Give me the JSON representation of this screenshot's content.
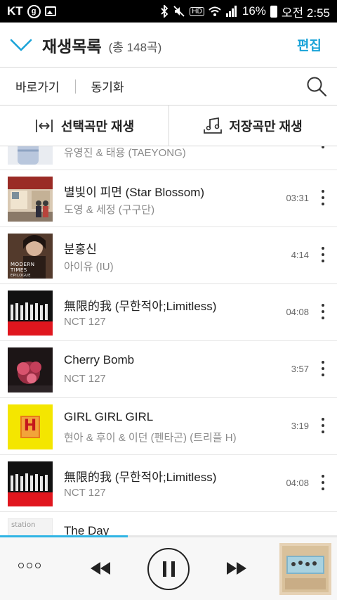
{
  "status_bar": {
    "carrier": "KT",
    "battery_percent": "16%",
    "time": "오전 2:55",
    "icons": [
      "g-badge-icon",
      "image-icon",
      "bluetooth-icon",
      "mute-icon",
      "hd-icon",
      "wifi-icon",
      "signal-icon",
      "battery-icon"
    ]
  },
  "header": {
    "title": "재생목록",
    "count": "(총 148곡)",
    "edit_label": "편집",
    "accent_color": "#1aa3d8"
  },
  "subbar": {
    "shortcut_label": "바로가기",
    "sync_label": "동기화"
  },
  "playbar": {
    "selected_only_label": "선택곡만 재생",
    "saved_only_label": "저장곡만 재생"
  },
  "songs": [
    {
      "title": "",
      "artist": "유영진 & 태용 (TAEYONG)",
      "duration": ""
    },
    {
      "title": "별빛이 피면 (Star Blossom)",
      "artist": "도영 & 세정 (구구단)",
      "duration": "03:31"
    },
    {
      "title": "분홍신",
      "artist": "아이유 (IU)",
      "duration": "4:14"
    },
    {
      "title": "無限的我 (무한적아;Limitless)",
      "artist": "NCT 127",
      "duration": "04:08"
    },
    {
      "title": "Cherry Bomb",
      "artist": "NCT 127",
      "duration": "3:57"
    },
    {
      "title": "GIRL GIRL GIRL",
      "artist": "현아 & 후이 & 이던 (펜타곤) (트리플 H)",
      "duration": "3:19"
    },
    {
      "title": "無限的我 (무한적아;Limitless)",
      "artist": "NCT 127",
      "duration": "04:08"
    },
    {
      "title": "The Day",
      "artist": "",
      "duration": ""
    }
  ],
  "album_art": {
    "modern_times_text": "MODERN TIMES",
    "epilogue_text": "EPILOGUE",
    "triple_h_letter": "H",
    "station_text": "station"
  },
  "player": {
    "progress": 0.38
  }
}
